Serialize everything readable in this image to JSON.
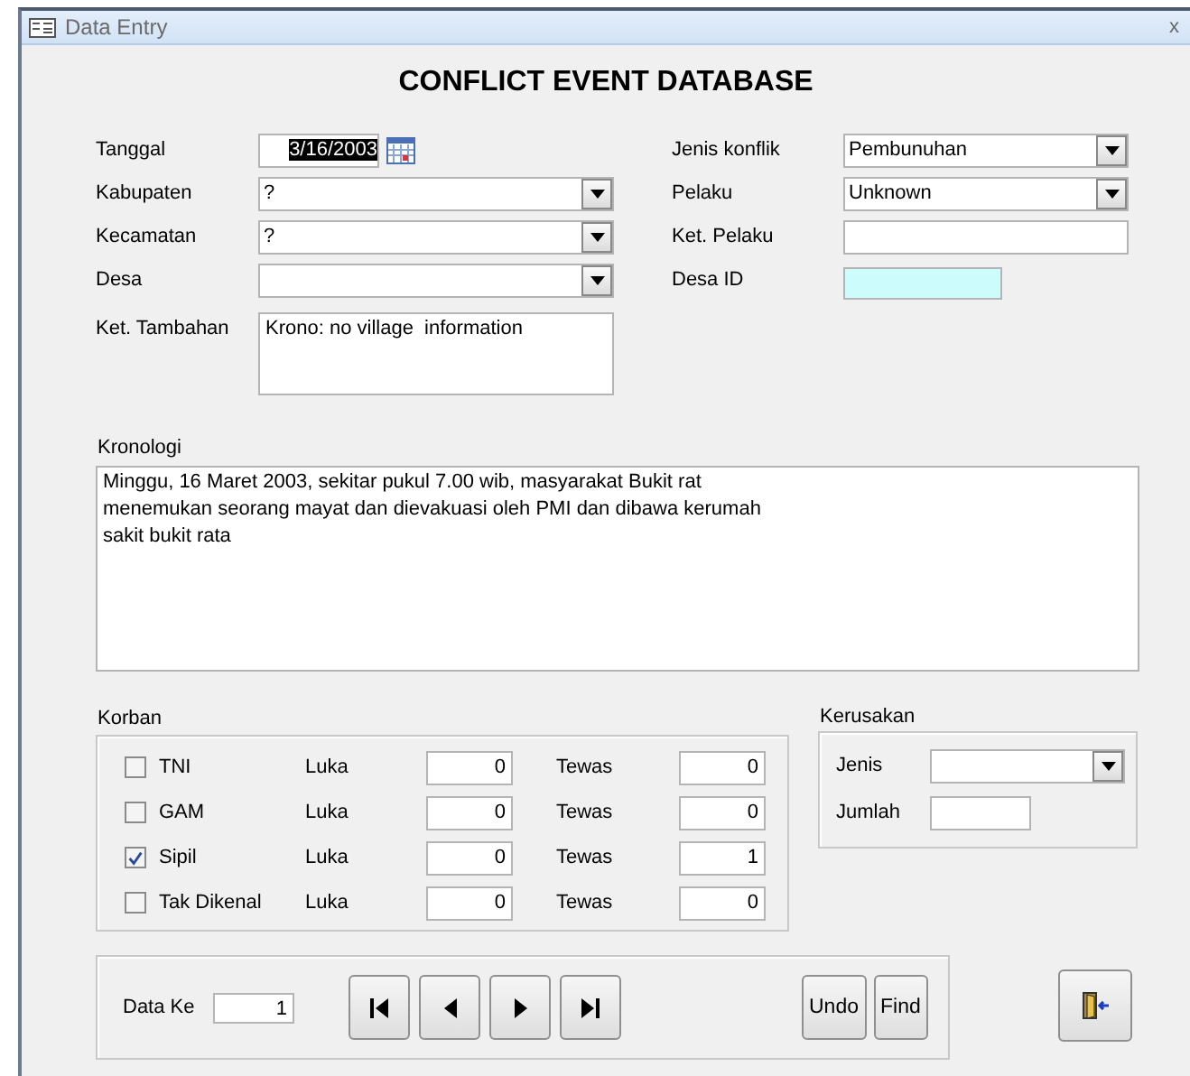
{
  "window": {
    "title": "Data Entry",
    "close": "x"
  },
  "heading": "CONFLICT EVENT DATABASE",
  "left_fields": [
    {
      "label": "Tanggal",
      "kind": "date",
      "value": "3/16/2003",
      "text_selected": true
    },
    {
      "label": "Kabupaten",
      "kind": "combo",
      "value": "?"
    },
    {
      "label": "Kecamatan",
      "kind": "combo",
      "value": "?"
    },
    {
      "label": "Desa",
      "kind": "combo"
    },
    {
      "label": "Ket. Tambahan",
      "kind": "memo",
      "value": "Krono: no village  information"
    }
  ],
  "right_fields": [
    {
      "label": "Jenis konflik",
      "kind": "combo",
      "value": "Pembunuhan"
    },
    {
      "label": "Pelaku",
      "kind": "combo",
      "value": "Unknown"
    },
    {
      "label": "Ket. Pelaku",
      "kind": "text"
    },
    {
      "label": "Desa ID",
      "kind": "readonly"
    }
  ],
  "kronologi": {
    "label": "Kronologi",
    "value": "Minggu, 16 Maret 2003, sekitar pukul 7.00 wib, masyarakat Bukit rat\nmenemukan seorang mayat dan dievakuasi oleh PMI dan dibawa kerumah\nsakit bukit rata"
  },
  "korban": {
    "label": "Korban",
    "rows": [
      {
        "name": "TNI",
        "checked": false,
        "luka_label": "Luka",
        "luka": "0",
        "tewas_label": "Tewas",
        "tewas": "0"
      },
      {
        "name": "GAM",
        "checked": false,
        "luka_label": "Luka",
        "luka": "0",
        "tewas_label": "Tewas",
        "tewas": "0"
      },
      {
        "name": "Sipil",
        "checked": true,
        "luka_label": "Luka",
        "luka": "0",
        "tewas_label": "Tewas",
        "tewas": "1"
      },
      {
        "name": "Tak Dikenal",
        "checked": false,
        "luka_label": "Luka",
        "luka": "0",
        "tewas_label": "Tewas",
        "tewas": "0"
      }
    ]
  },
  "kerusakan": {
    "label": "Kerusakan",
    "fields": [
      {
        "label": "Jenis",
        "kind": "combo"
      },
      {
        "label": "Jumlah",
        "kind": "text"
      }
    ]
  },
  "navigation": {
    "label": "Data Ke",
    "value": "1",
    "buttons": [
      {
        "kind": "first"
      },
      {
        "kind": "previous"
      },
      {
        "kind": "next"
      },
      {
        "kind": "last"
      }
    ],
    "actions": [
      "Undo",
      "Find"
    ]
  },
  "exit_button": {
    "kind": "exit"
  }
}
